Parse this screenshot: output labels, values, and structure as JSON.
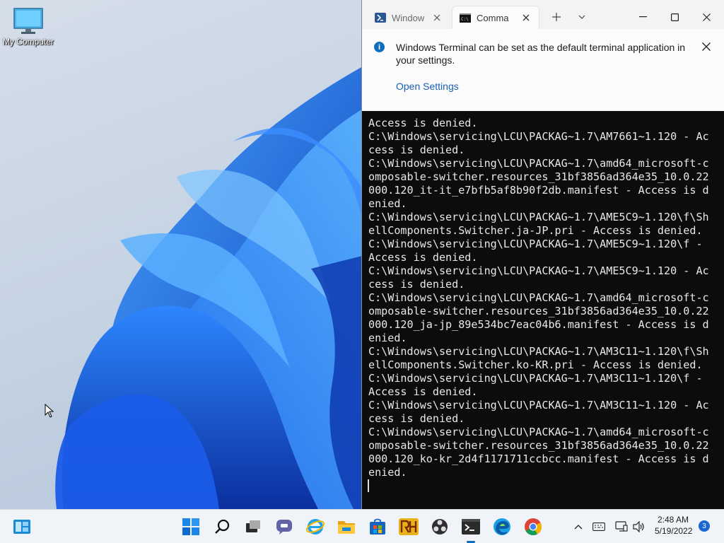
{
  "desktop": {
    "icons": [
      {
        "label": "My Computer"
      }
    ]
  },
  "terminal": {
    "tabs": [
      {
        "label": "Window",
        "active": false
      },
      {
        "label": "Comma",
        "active": true
      }
    ],
    "infobar": {
      "message": "Windows Terminal can be set as the default terminal application in your settings.",
      "link": "Open Settings",
      "icon": "i"
    },
    "console_lines": [
      "Access is denied.",
      "C:\\Windows\\servicing\\LCU\\PACKAG~1.7\\AM7661~1.120 - Ac",
      "cess is denied.",
      "C:\\Windows\\servicing\\LCU\\PACKAG~1.7\\amd64_microsoft-c",
      "omposable-switcher.resources_31bf3856ad364e35_10.0.22",
      "000.120_it-it_e7bfb5af8b90f2db.manifest - Access is d",
      "enied.",
      "C:\\Windows\\servicing\\LCU\\PACKAG~1.7\\AME5C9~1.120\\f\\Sh",
      "ellComponents.Switcher.ja-JP.pri - Access is denied.",
      "C:\\Windows\\servicing\\LCU\\PACKAG~1.7\\AME5C9~1.120\\f -",
      "Access is denied.",
      "C:\\Windows\\servicing\\LCU\\PACKAG~1.7\\AME5C9~1.120 - Ac",
      "cess is denied.",
      "C:\\Windows\\servicing\\LCU\\PACKAG~1.7\\amd64_microsoft-c",
      "omposable-switcher.resources_31bf3856ad364e35_10.0.22",
      "000.120_ja-jp_89e534bc7eac04b6.manifest - Access is d",
      "enied.",
      "C:\\Windows\\servicing\\LCU\\PACKAG~1.7\\AM3C11~1.120\\f\\Sh",
      "ellComponents.Switcher.ko-KR.pri - Access is denied.",
      "C:\\Windows\\servicing\\LCU\\PACKAG~1.7\\AM3C11~1.120\\f -",
      "Access is denied.",
      "C:\\Windows\\servicing\\LCU\\PACKAG~1.7\\AM3C11~1.120 - Ac",
      "cess is denied.",
      "C:\\Windows\\servicing\\LCU\\PACKAG~1.7\\amd64_microsoft-c",
      "omposable-switcher.resources_31bf3856ad364e35_10.0.22",
      "000.120_ko-kr_2d4f1171711ccbcc.manifest - Access is d",
      "enied."
    ]
  },
  "taskbar": {
    "apps": [
      "start-icon",
      "search-icon",
      "task-view-icon",
      "chat-icon",
      "internet-explorer-icon",
      "file-explorer-icon",
      "store-icon",
      "rh-app-icon",
      "obs-icon",
      "terminal-icon",
      "edge-icon",
      "chrome-icon"
    ],
    "tray": {
      "time": "2:48 AM",
      "date": "5/19/2022",
      "notifications": "3"
    },
    "colors": {
      "accent": "#0f6cbd",
      "edge": "#1a9ee6",
      "chrome_red": "#db4437"
    }
  }
}
